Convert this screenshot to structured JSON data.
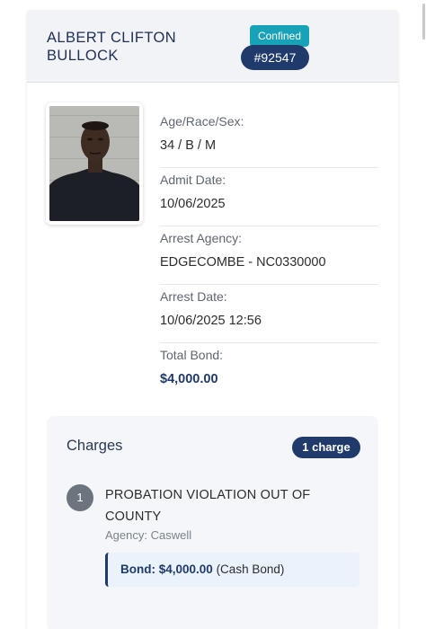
{
  "inmate": {
    "name_line1": "ALBERT CLIFTON",
    "name_line2": "BULLOCK",
    "status": "Confined",
    "booking_number": "#92547"
  },
  "details": [
    {
      "label": "Age/Race/Sex:",
      "value": "34 / B / M"
    },
    {
      "label": "Admit Date:",
      "value": "10/06/2025"
    },
    {
      "label": "Arrest Agency:",
      "value": "EDGECOMBE - NC0330000"
    },
    {
      "label": "Arrest Date:",
      "value": "10/06/2025 12:56"
    },
    {
      "label": "Total Bond:",
      "value": "$4,000.00"
    }
  ],
  "charges": {
    "title": "Charges",
    "count_label": "1 charge",
    "items": [
      {
        "index": "1",
        "description": "PROBATION VIOLATION OUT OF COUNTY",
        "agency": "Agency: Caswell",
        "bond_label": "Bond: $4,000.00",
        "bond_type": "(Cash Bond)"
      }
    ]
  },
  "colors": {
    "navy": "#1f3a6b",
    "status_teal": "#17a2b8",
    "header_bg": "#f1f3f6",
    "bond_bg": "#eaf3fc"
  }
}
